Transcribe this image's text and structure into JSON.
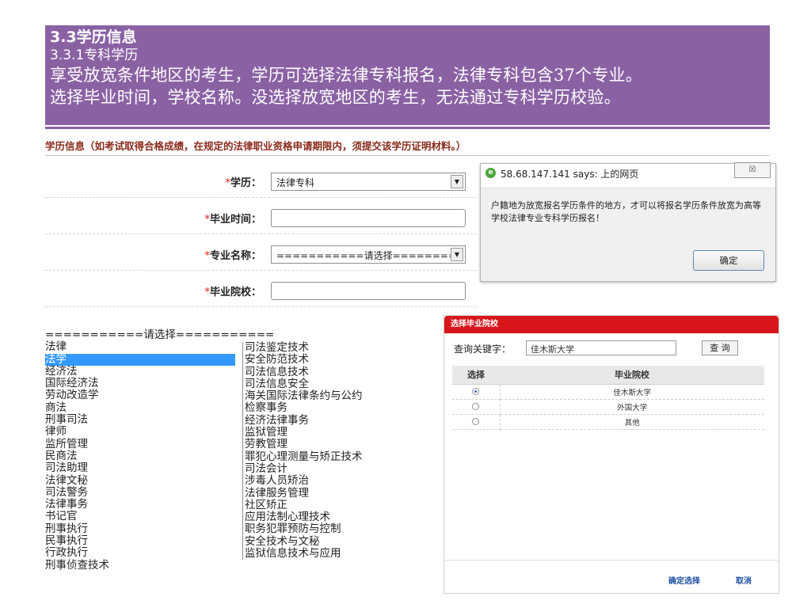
{
  "banner": {
    "title": "3.3学历信息",
    "subtitle": "3.3.1专科学历",
    "line1": "享受放宽条件地区的考生，学历可选择法律专科报名，法律专科包含37个专业。",
    "line2": "选择毕业时间，学校名称。没选择放宽地区的考生，无法通过专科学历校验。"
  },
  "form": {
    "header": "学历信息（如考试取得合格成绩，在规定的法律职业资格申请期限内，须提交该学历证明材料。）",
    "required_mark": "*",
    "education_label": "学历：",
    "education_value": "法律专科",
    "grad_time_label": "毕业时间：",
    "grad_time_value": "",
    "major_label": "专业名称：",
    "major_value": "===========请选择===========",
    "school_label": "毕业院校：",
    "school_value": ""
  },
  "alert": {
    "title": "58.68.147.141 says: 上的网页",
    "close_label": "☒",
    "message": "户籍地为放宽报名学历条件的地方，才可以将报名学历条件放宽为高等学校法律专业专科学历报名！",
    "ok_label": "确定"
  },
  "majors_left": [
    "===========请选择===========",
    "法律",
    "法学",
    "经济法",
    "国际经济法",
    "劳动改造学",
    "商法",
    "刑事司法",
    "律师",
    "监所管理",
    "民商法",
    "司法助理",
    "法律文秘",
    "司法警务",
    "法律事务",
    "书记官",
    "刑事执行",
    "民事执行",
    "行政执行",
    "刑事侦查技术"
  ],
  "majors_right": [
    "司法鉴定技术",
    "安全防范技术",
    "司法信息技术",
    "司法信息安全",
    "海关国际法律条约与公约",
    "检察事务",
    "经济法律事务",
    "监狱管理",
    "劳教管理",
    "罪犯心理测量与矫正技术",
    "司法会计",
    "涉毒人员矫治",
    "法律服务管理",
    "社区矫正",
    "应用法制心理技术",
    "职务犯罪预防与控制",
    "安全技术与文秘",
    "监狱信息技术与应用"
  ],
  "school_dialog": {
    "title": "选择毕业院校",
    "query_label": "查询关键字：",
    "query_value": "佳木斯大学",
    "query_button": "查 询",
    "col_select": "选择",
    "col_school": "毕业院校",
    "rows": [
      "佳木斯大学",
      "外国大学",
      "其他"
    ],
    "confirm_label": "确定选择",
    "cancel_label": "取消"
  },
  "colors": {
    "banner_bg": "#8a62a4",
    "dialog_header": "#d9161b",
    "list_highlight": "#3399ff"
  }
}
